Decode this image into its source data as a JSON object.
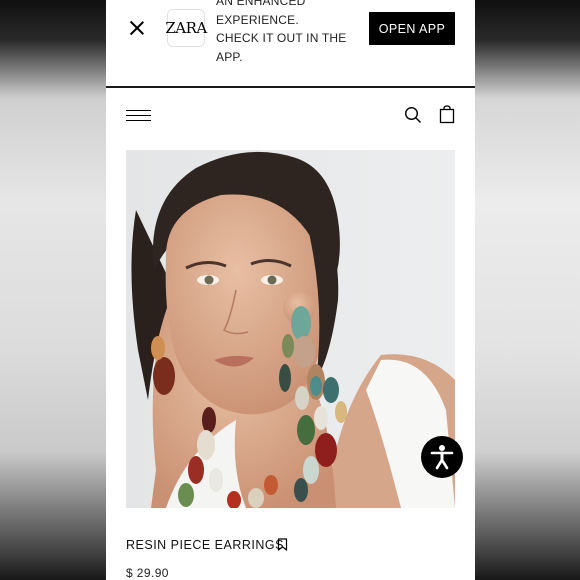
{
  "app_banner": {
    "brand_logo_text": "ZARA",
    "message_lines": [
      "AN ENHANCED",
      "EXPERIENCE.",
      "CHECK IT OUT IN THE",
      "APP."
    ],
    "open_app_label": "OPEN APP",
    "icons": {
      "close": "close-icon"
    }
  },
  "header": {
    "icons": {
      "menu": "hamburger-menu-icon",
      "search": "search-icon",
      "bag": "shopping-bag-icon"
    }
  },
  "product": {
    "name": "RESIN PIECE EARRINGS",
    "price": "$ 29.90",
    "icons": {
      "bookmark": "bookmark-icon"
    }
  },
  "accessibility": {
    "icon": "accessibility-icon",
    "background_color": "#000000"
  }
}
